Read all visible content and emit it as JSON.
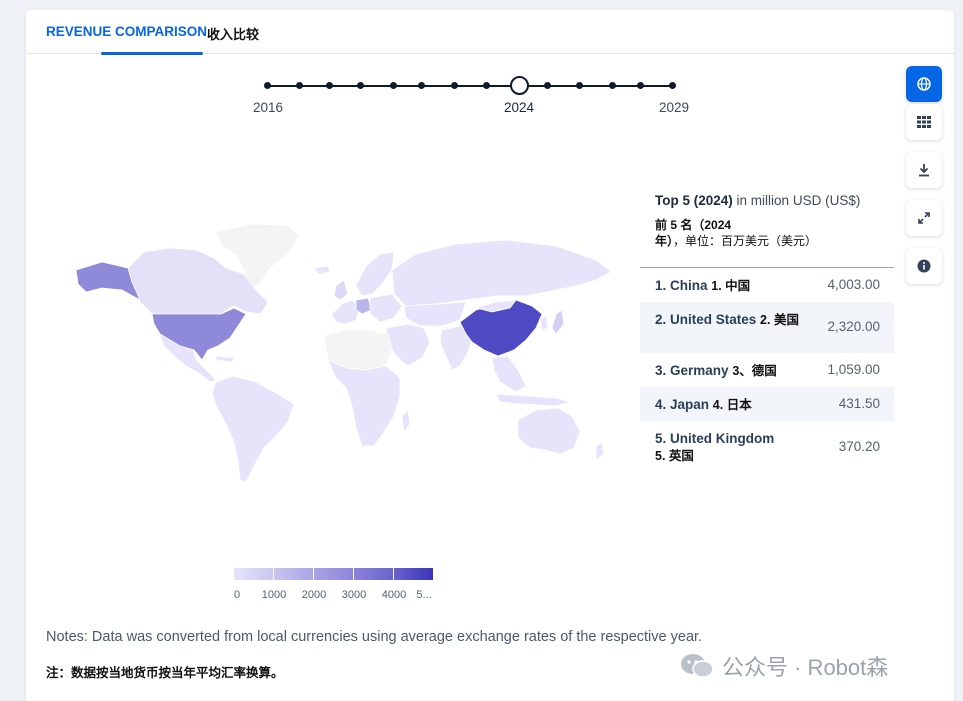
{
  "tabs": {
    "active_label_en": "REVENUE COMPARISON",
    "active_label_cn": "收入比较"
  },
  "timeline": {
    "start_label": "2016",
    "current_label": "2024",
    "end_label": "2029",
    "years": [
      "2016",
      "2017",
      "2018",
      "2019",
      "2020",
      "2021",
      "2022",
      "2023",
      "2024",
      "2025",
      "2026",
      "2027",
      "2028",
      "2029"
    ],
    "selected_year": "2024"
  },
  "toolbar": {
    "icons": [
      "globe-icon",
      "table-icon",
      "download-icon",
      "fullscreen-icon",
      "info-icon"
    ],
    "active": "globe-icon"
  },
  "top5": {
    "title_bold": "Top 5 (2024)",
    "title_rest": "in million USD (US$)",
    "subtitle_cn_bold": "前 5 名（2024 年）",
    "subtitle_cn_rest": "，单位：百万美元（美元）",
    "rows": [
      {
        "name": "1. China",
        "name_cn": "1. 中国",
        "value": "4,003.00"
      },
      {
        "name": "2. United States",
        "name_cn": "2. 美国",
        "value": "2,320.00"
      },
      {
        "name": "3. Germany",
        "name_cn": "3、德国",
        "value": "1,059.00"
      },
      {
        "name": "4. Japan",
        "name_cn": "4. 日本",
        "value": "431.50"
      },
      {
        "name": "5. United Kingdom",
        "name_cn": "5. 英国",
        "value": "370.20"
      }
    ]
  },
  "legend": {
    "labels": [
      "0",
      "1000",
      "2000",
      "3000",
      "4000",
      "5..."
    ],
    "colors": [
      "#e6e3fa",
      "#c9c5f0",
      "#a9a4e6",
      "#8a84db",
      "#6a62cf",
      "#3934b8"
    ]
  },
  "map_colors": {
    "default": "#e6e3fa",
    "no_data": "#f4f4f4",
    "china": "#4d4ac4",
    "united_states": "#8e8ad9",
    "alaska": "#8e8ad9",
    "germany": "#b9b5ea",
    "canada": "#e3e0f8"
  },
  "notes": {
    "en": "Notes: Data was converted from local currencies using average exchange rates of the respective year.",
    "cn": "注：数据按当地货币按当年平均汇率换算。"
  },
  "watermark": {
    "text": "公众号 · Robot森"
  }
}
